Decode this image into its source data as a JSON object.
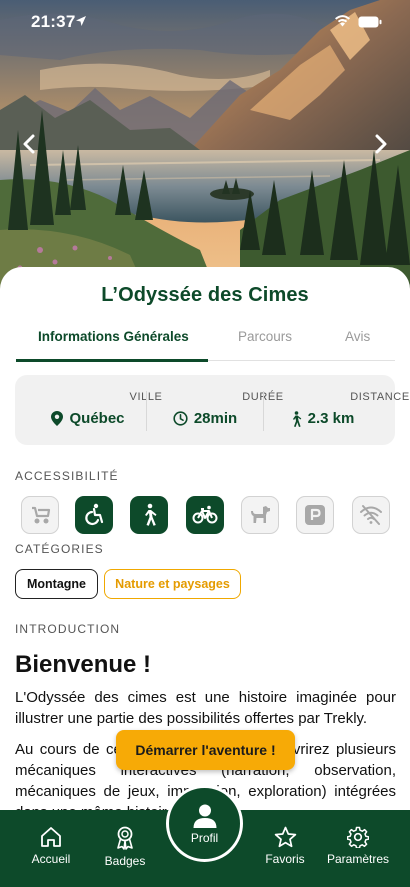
{
  "status_bar": {
    "time": "21:37"
  },
  "carousel": {
    "prev_icon": "chevron-left-icon",
    "next_icon": "chevron-right-icon"
  },
  "title": "L’Odyssée des Cimes",
  "tabs": [
    {
      "label": "Informations Générales",
      "active": true
    },
    {
      "label": "Parcours",
      "active": false
    },
    {
      "label": "Avis",
      "active": false
    }
  ],
  "info": {
    "city": {
      "label": "VILLE",
      "value": "Québec",
      "icon": "map-pin-icon"
    },
    "duration": {
      "label": "DURÉE",
      "value": "28min",
      "icon": "clock-icon"
    },
    "distance": {
      "label": "DISTANCE",
      "value": "2.3 km",
      "icon": "walking-icon"
    }
  },
  "accessibility": {
    "label": "ACCESSIBILITÉ",
    "items": [
      {
        "name": "stroller-icon",
        "active": false
      },
      {
        "name": "wheelchair-icon",
        "active": true
      },
      {
        "name": "walking-icon",
        "active": true
      },
      {
        "name": "bicycle-icon",
        "active": true
      },
      {
        "name": "dog-icon",
        "active": false
      },
      {
        "name": "parking-icon",
        "active": false
      },
      {
        "name": "no-wifi-icon",
        "active": false
      }
    ]
  },
  "categories": {
    "label": "CATÉGORIES",
    "items": [
      "Montagne",
      "Nature et paysages"
    ]
  },
  "introduction": {
    "label": "INTRODUCTION",
    "heading": "Bienvenue !",
    "paragraph1": "L'Odyssée des cimes est une histoire imaginée pour illustrer une partie des possibilités offertes par Trekly.",
    "paragraph2": "Au cours de cette aventure, vous découvrirez plusieurs mécaniques interactives (narration, observation, mécaniques de jeux, immersion, exploration) intégrées dans une même histoire."
  },
  "cta": {
    "label": "Démarrer l'aventure !"
  },
  "bottom_nav": {
    "home": "Accueil",
    "badges": "Badges",
    "profile": "Profil",
    "favorites": "Favoris",
    "settings": "Paramètres"
  },
  "colors": {
    "brand_green": "#0d4a2a",
    "accent_gold": "#f7aa06",
    "panel_gray": "#f1f1f1"
  }
}
